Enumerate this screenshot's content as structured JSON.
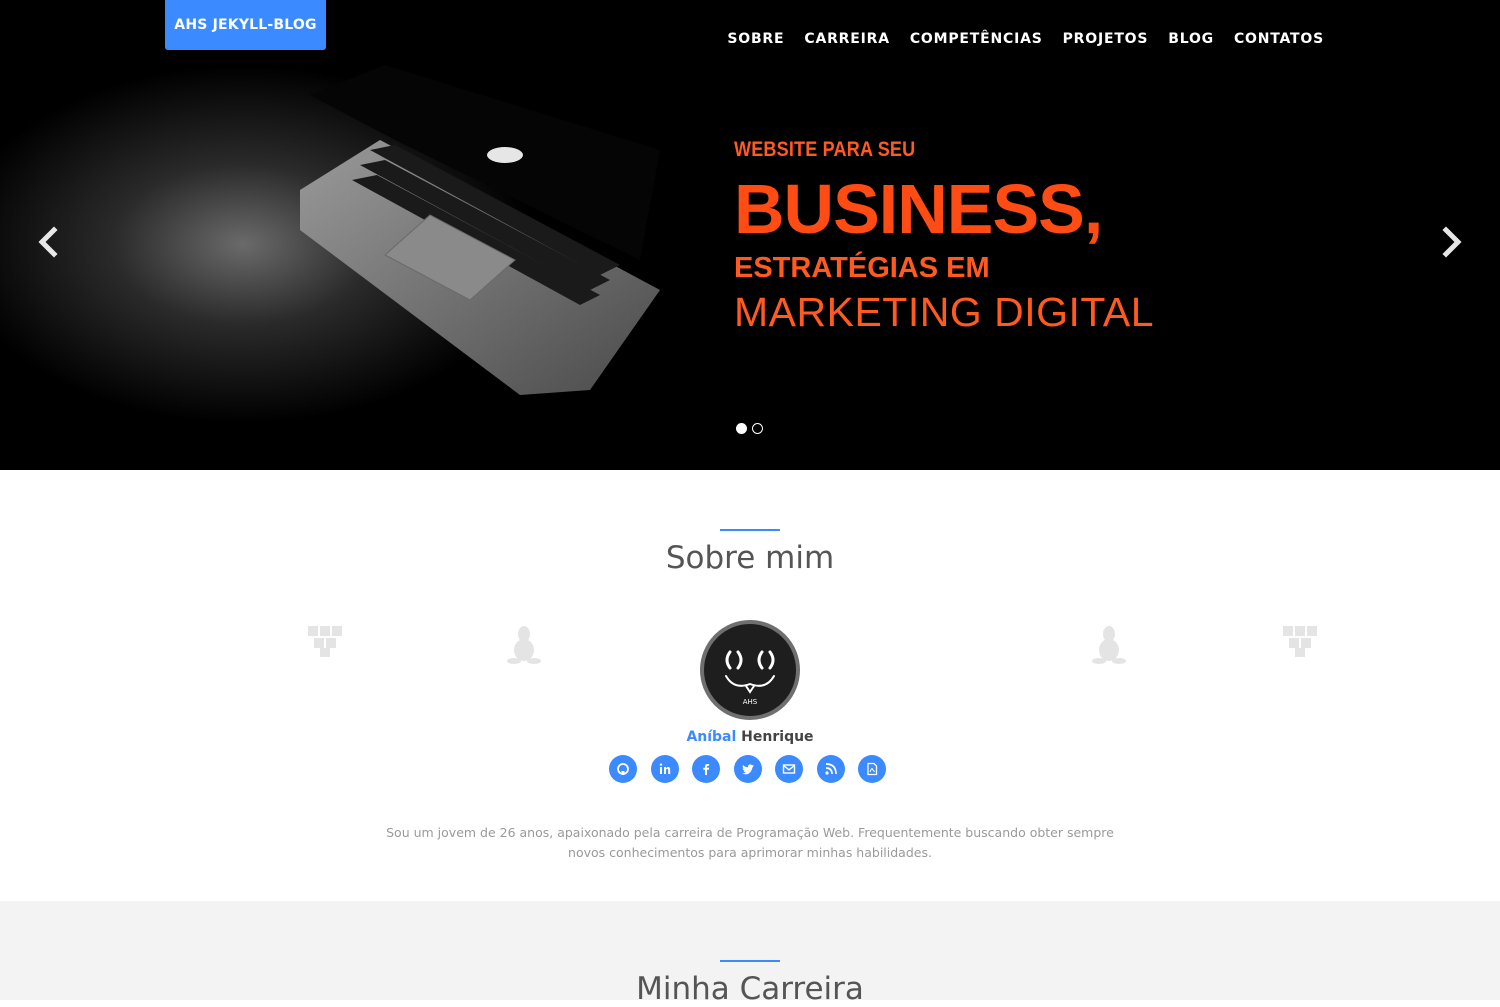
{
  "brand": {
    "label": "AHS JEKYLL-BLOG"
  },
  "nav": {
    "items": [
      "SOBRE",
      "CARREIRA",
      "COMPETÊNCIAS",
      "PROJETOS",
      "BLOG",
      "CONTATOS"
    ]
  },
  "hero": {
    "slide": {
      "line1": "WEBSITE PARA SEU",
      "line2": "BUSINESS,",
      "line3": "ESTRATÉGIAS EM",
      "line4": "MARKETING DIGITAL"
    },
    "prev_icon": "chevron-left-icon",
    "next_icon": "chevron-right-icon",
    "indicators": {
      "count": 2,
      "active": 0
    },
    "accent_color": "#ff5a1f"
  },
  "about": {
    "title": "Sobre mim",
    "name_first": "Aníbal",
    "name_last": " Henrique",
    "avatar_label": "AHS",
    "socials": [
      "github-icon",
      "linkedin-icon",
      "facebook-icon",
      "twitter-icon",
      "email-icon",
      "rss-icon",
      "pdf-icon"
    ],
    "bio": "Sou um jovem de 26 anos, apaixonado pela carreira de Programação Web. Frequentemente buscando obter sempre novos conhecimentos para aprimorar minhas habilidades."
  },
  "career": {
    "title": "Minha Carreira"
  },
  "colors": {
    "primary": "#3b8aff",
    "dark": "#000000",
    "section_alt": "#f3f3f3"
  }
}
